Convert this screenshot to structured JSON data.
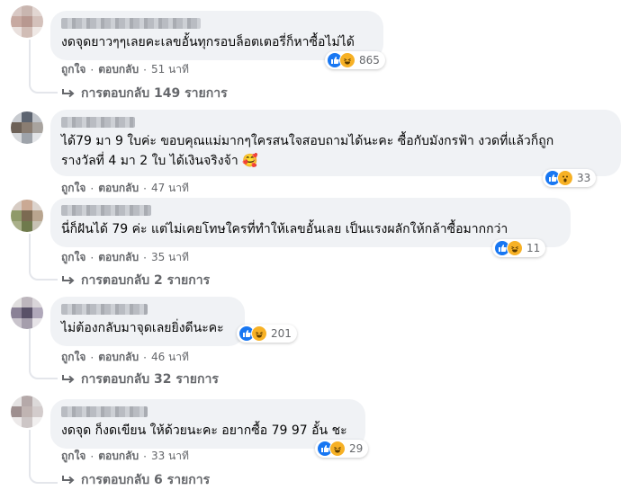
{
  "comments": [
    {
      "text_lines": [
        "งดจุดยาวๆๆเลยคะเลขอั้นทุกรอบล็อตเตอรี่ก็หาซื้อไม่ได้"
      ],
      "reactions": [
        "like",
        "haha"
      ],
      "reaction_count": "865",
      "like_label": "ถูกใจ",
      "reply_label": "ตอบกลับ",
      "time": "51 นาที",
      "replies_label": "การตอบกลับ 149 รายการ"
    },
    {
      "text_lines": [
        "ได้79 มา 9 ใบค่ะ ขอบคุณแม่มากๆใครสนใจสอบถามได้นะคะ ซื้อกับมังกรฟ้า งวดที่แล้วก็ถูก",
        "รางวัลที่ 4 มา 2 ใบ ได้เงินจริงจ้า 🥰"
      ],
      "reactions": [
        "like",
        "wow"
      ],
      "reaction_count": "33",
      "like_label": "ถูกใจ",
      "reply_label": "ตอบกลับ",
      "time": "47 นาที",
      "replies_label": ""
    },
    {
      "text_lines": [
        "นี่ก็ฝันได้ 79 ค่ะ แต่ไม่เคยโทษใครที่ทำให้เลขอั้นเลย เป็นแรงผลักให้กล้าซื้อมากกว่า"
      ],
      "reactions": [
        "like",
        "haha"
      ],
      "reaction_count": "11",
      "like_label": "ถูกใจ",
      "reply_label": "ตอบกลับ",
      "time": "35 นาที",
      "replies_label": "การตอบกลับ 2 รายการ"
    },
    {
      "text_lines": [
        "ไม่ต้องกลับมาจุดเลยยิ่งดีนะคะ"
      ],
      "reactions": [
        "like",
        "haha"
      ],
      "reaction_count": "201",
      "like_label": "ถูกใจ",
      "reply_label": "ตอบกลับ",
      "time": "46 นาที",
      "replies_label": "การตอบกลับ 32 รายการ"
    },
    {
      "text_lines": [
        "งดจุด ก็งดเขียน ให้ด้วยนะคะ อยากซื้อ 79 97 อั้น ชะ"
      ],
      "reactions": [
        "like",
        "haha"
      ],
      "reaction_count": "29",
      "like_label": "ถูกใจ",
      "reply_label": "ตอบกลับ",
      "time": "33 นาที",
      "replies_label": "การตอบกลับ 6 รายการ"
    }
  ],
  "colors": {
    "bubble": "#f0f2f5",
    "meta": "#65676b",
    "like": "#1877f2",
    "emoji": "#f7b125"
  }
}
